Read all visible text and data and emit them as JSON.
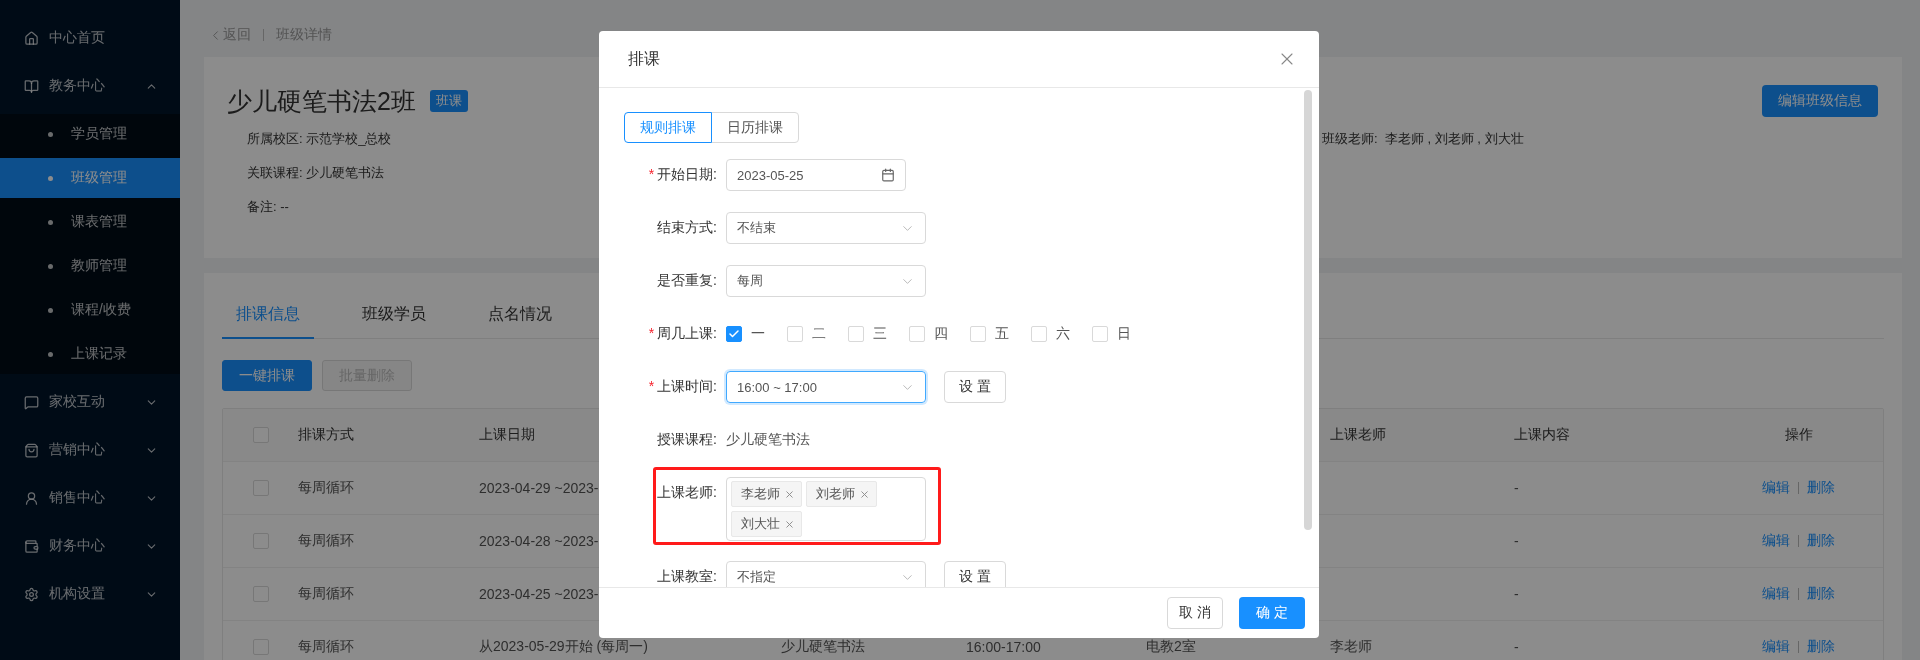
{
  "sidebar": {
    "items": [
      {
        "label": "中心首页",
        "selected": false
      },
      {
        "label": "教务中心",
        "selected": false,
        "expanded": true,
        "children": [
          {
            "label": "学员管理",
            "selected": false
          },
          {
            "label": "班级管理",
            "selected": true
          },
          {
            "label": "课表管理",
            "selected": false
          },
          {
            "label": "教师管理",
            "selected": false
          },
          {
            "label": "课程/收费",
            "selected": false
          },
          {
            "label": "上课记录",
            "selected": false
          }
        ]
      },
      {
        "label": "家校互动",
        "selected": false,
        "expanded": false
      },
      {
        "label": "营销中心",
        "selected": false,
        "expanded": false
      },
      {
        "label": "销售中心",
        "selected": false,
        "expanded": false
      },
      {
        "label": "财务中心",
        "selected": false,
        "expanded": false
      },
      {
        "label": "机构设置",
        "selected": false,
        "expanded": false
      }
    ]
  },
  "breadcrumb": {
    "back": "返回",
    "current": "班级详情"
  },
  "class_card": {
    "title": "少儿硬笔书法2班",
    "tag": "班课",
    "info": [
      "所属校区: 示范学校_总校",
      "关联课程: 少儿硬笔书法",
      "备注: --"
    ],
    "teachers": "班级老师:  李老师 , 刘老师 , 刘大壮",
    "edit_button": "编辑班级信息"
  },
  "tabs": [
    {
      "label": "排课信息",
      "selected": true
    },
    {
      "label": "班级学员",
      "selected": false
    },
    {
      "label": "点名情况",
      "selected": false
    }
  ],
  "actions": [
    {
      "label": "一键排课",
      "disabled": false
    },
    {
      "label": "批量删除",
      "disabled": true
    }
  ],
  "table": {
    "all_checked": false,
    "columns": {
      "method": "排课方式",
      "date": "上课日期",
      "teacher": "上课老师",
      "content": "上课内容",
      "actions": "操作"
    },
    "rows": [
      {
        "checked": false,
        "method": "每周循环",
        "date": "2023-04-29 ~2023-",
        "content": "-",
        "edit": "编辑",
        "delete": "删除"
      },
      {
        "checked": false,
        "method": "每周循环",
        "date": "2023-04-28 ~2023-",
        "content": "-",
        "edit": "编辑",
        "delete": "删除"
      },
      {
        "checked": false,
        "method": "每周循环",
        "date": "2023-04-25 ~2023-",
        "content": "-",
        "edit": "编辑",
        "delete": "删除"
      },
      {
        "checked": false,
        "method": "每周循环",
        "date": "从2023-05-29开始 (每周一)",
        "course": "少儿硬笔书法",
        "time": "16:00-17:00",
        "room": "电教2室",
        "teacher": "李老师",
        "content": "-",
        "edit": "编辑",
        "delete": "删除"
      }
    ]
  },
  "modal": {
    "title": "排课",
    "modes": [
      {
        "label": "规则排课",
        "selected": true
      },
      {
        "label": "日历排课",
        "selected": false
      }
    ],
    "fields": [
      {
        "kind": "date",
        "label": "开始日期:",
        "required": "*",
        "value": "2023-05-25"
      },
      {
        "kind": "select",
        "label": "结束方式:",
        "value": "不结束"
      },
      {
        "kind": "select",
        "label": "是否重复:",
        "value": "每周"
      },
      {
        "kind": "weekdays",
        "label": "周几上课:",
        "required": "*",
        "options": [
          {
            "label": "一",
            "checked": true
          },
          {
            "label": "二",
            "checked": false
          },
          {
            "label": "三",
            "checked": false
          },
          {
            "label": "四",
            "checked": false
          },
          {
            "label": "五",
            "checked": false
          },
          {
            "label": "六",
            "checked": false
          },
          {
            "label": "日",
            "checked": false
          }
        ]
      },
      {
        "kind": "select",
        "label": "上课时间:",
        "required": "*",
        "value": "16:00 ~ 17:00",
        "focused": true,
        "button": "设 置"
      },
      {
        "kind": "text",
        "label": "授课课程:",
        "value": "少儿硬笔书法"
      },
      {
        "kind": "tags",
        "label": "上课老师:",
        "highlighted": true,
        "tags": [
          "李老师",
          "刘老师",
          "刘大壮"
        ]
      },
      {
        "kind": "select",
        "label": "上课教室:",
        "value": "不指定",
        "button": "设 置"
      }
    ],
    "cancel": "取 消",
    "ok": "确 定"
  }
}
